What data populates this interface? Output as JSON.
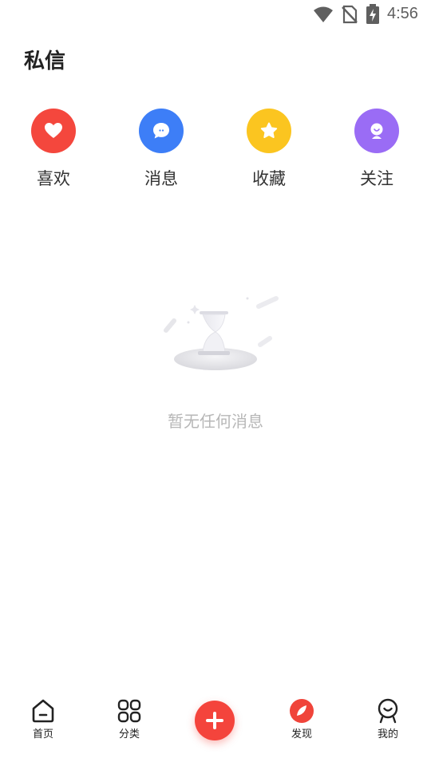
{
  "status_bar": {
    "time": "4:56",
    "icons": [
      "wifi-icon",
      "no-sim-icon",
      "battery-charging-icon"
    ]
  },
  "header": {
    "title": "私信"
  },
  "quick_actions": [
    {
      "label": "喜欢",
      "icon": "heart-icon",
      "color": "#f4473d"
    },
    {
      "label": "消息",
      "icon": "chat-bubble-icon",
      "color": "#3d7ef7"
    },
    {
      "label": "收藏",
      "icon": "star-icon",
      "color": "#fbc520"
    },
    {
      "label": "关注",
      "icon": "person-icon",
      "color": "#9a6cf5"
    }
  ],
  "empty_state": {
    "icon": "hourglass-icon",
    "text": "暂无任何消息"
  },
  "bottom_nav": {
    "items": [
      {
        "label": "首页",
        "icon": "home-icon",
        "active": false
      },
      {
        "label": "分类",
        "icon": "grid-icon",
        "active": false
      },
      {
        "label": "",
        "icon": "plus-icon",
        "active": false
      },
      {
        "label": "发现",
        "icon": "discover-icon",
        "active": true
      },
      {
        "label": "我的",
        "icon": "profile-icon",
        "active": false
      }
    ],
    "accent_color": "#f0443a"
  }
}
